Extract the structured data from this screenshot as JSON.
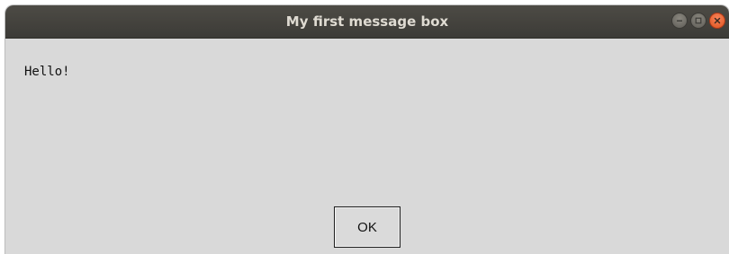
{
  "window": {
    "title": "My first message box",
    "controls": [
      {
        "name": "minimize",
        "icon": "minimize-icon"
      },
      {
        "name": "maximize",
        "icon": "maximize-icon"
      },
      {
        "name": "close",
        "icon": "close-icon"
      }
    ]
  },
  "dialog": {
    "message": "Hello!",
    "ok_label": "OK"
  },
  "colors": {
    "titlebar": "#3c3b37",
    "title_text": "#dfdbd2",
    "body_background": "#d9d9d9",
    "close_button": "#e95420"
  }
}
